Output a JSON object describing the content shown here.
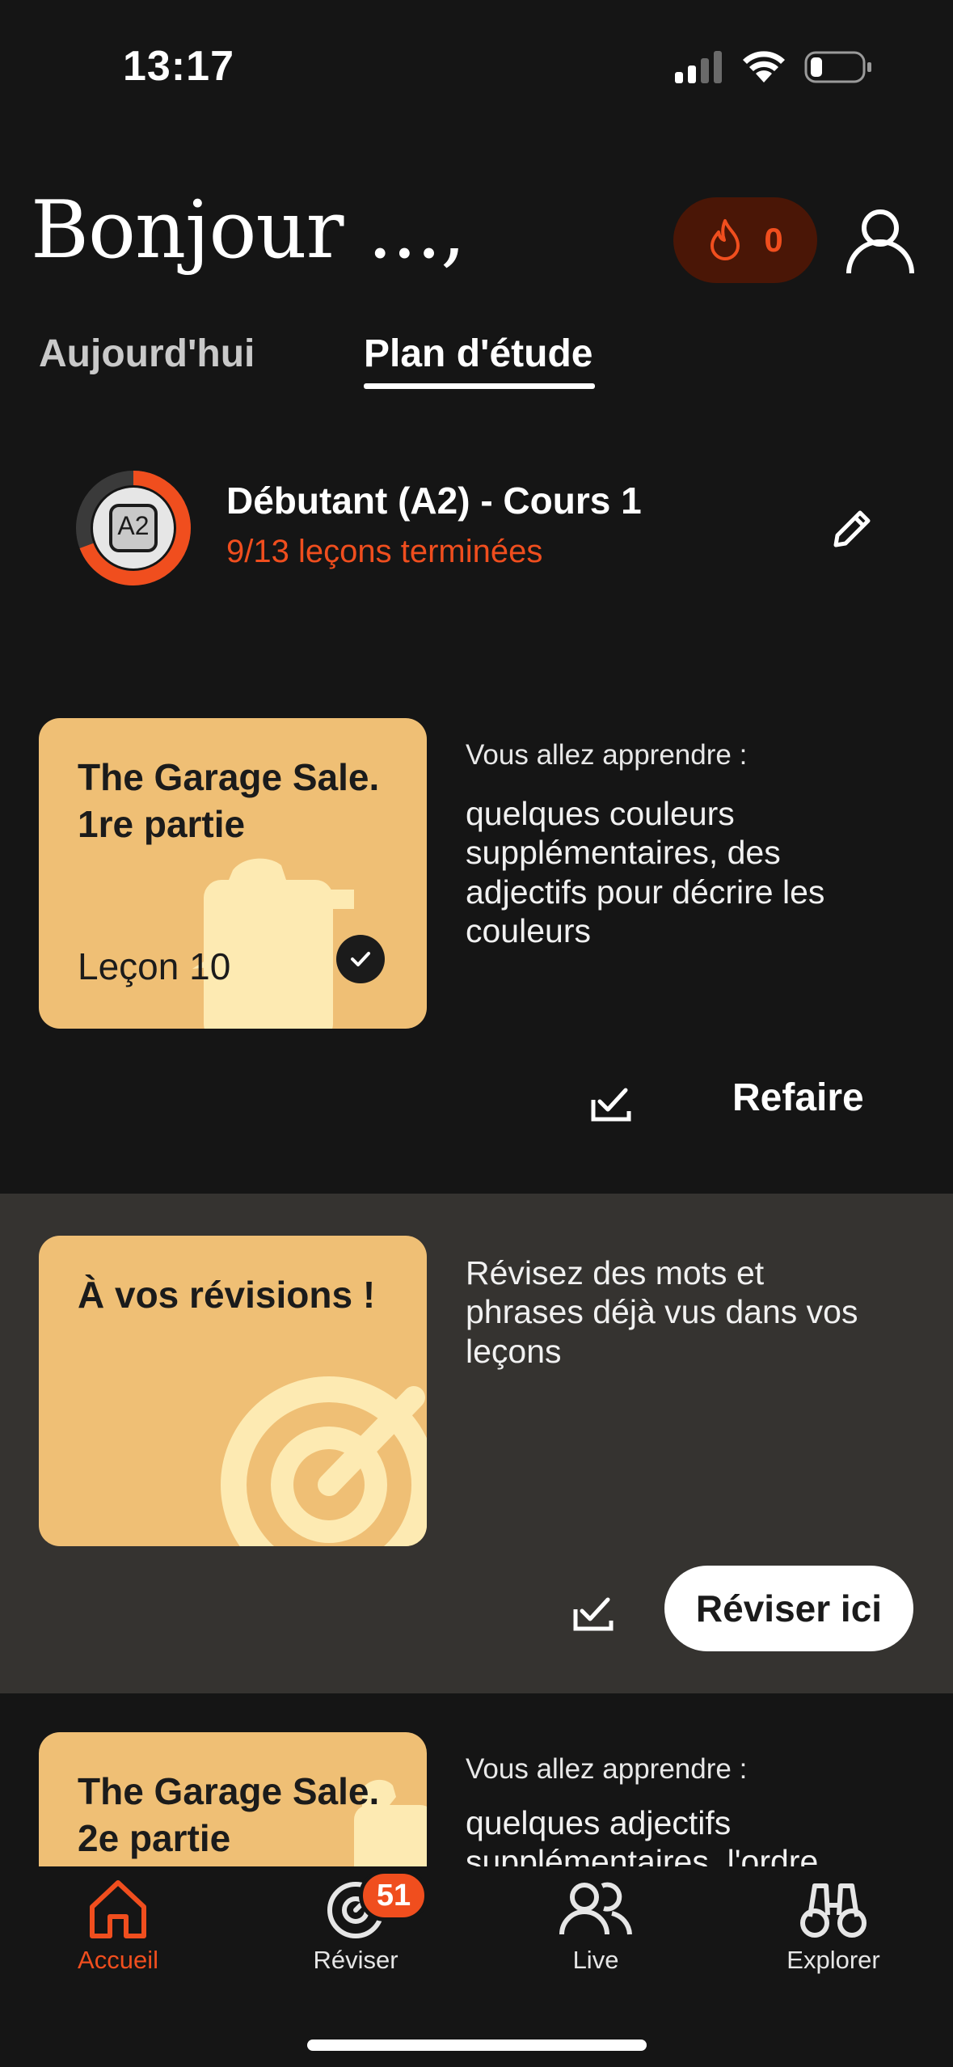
{
  "status_bar": {
    "time": "13:17"
  },
  "header": {
    "greeting": "Bonjour ...,",
    "streak_count": "0"
  },
  "tabs": [
    {
      "label": "Aujourd'hui",
      "active": false
    },
    {
      "label": "Plan d'étude",
      "active": true
    }
  ],
  "course": {
    "level_badge": "A2",
    "title": "Débutant (A2) - Cours 1",
    "progress_text": "9/13 leçons terminées",
    "completed": 9,
    "total": 13
  },
  "lessons": [
    {
      "title": "The Garage Sale. 1re partie",
      "subtitle": "Leçon 10",
      "learn_label": "Vous allez apprendre :",
      "learn_text": "quelques couleurs supplémentaires, des adjectifs pour décrire les couleurs",
      "action_label": "Refaire"
    },
    {
      "title": "À vos révisions !",
      "learn_text": "Révisez des mots et phrases déjà vus dans vos leçons",
      "action_label": "Réviser ici"
    },
    {
      "title": "The Garage Sale. 2e partie",
      "learn_label": "Vous allez apprendre :",
      "learn_text": "quelques adjectifs supplémentaires, l'ordre"
    }
  ],
  "bottom_nav": [
    {
      "label": "Accueil",
      "icon": "home-icon",
      "active": true
    },
    {
      "label": "Réviser",
      "icon": "target-icon",
      "badge": "51"
    },
    {
      "label": "Live",
      "icon": "people-icon"
    },
    {
      "label": "Explorer",
      "icon": "binoculars-icon"
    }
  ],
  "colors": {
    "accent": "#f04e1e",
    "card": "#efbf75",
    "background": "#151515"
  }
}
